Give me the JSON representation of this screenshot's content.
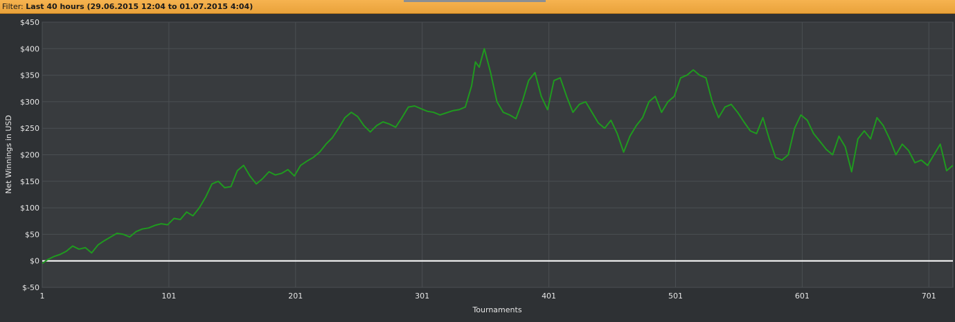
{
  "filter": {
    "label": "Filter:",
    "value": "Last 40 hours (29.06.2015 12:04 to 01.07.2015 4:04)"
  },
  "colors": {
    "background": "#2e3134",
    "plot_area": "#383b3e",
    "grid": "#4b4f53",
    "series_line": "#1f9a1f",
    "zero_line": "#ffffff",
    "filter_bar": "#f0aa45"
  },
  "chart_data": {
    "type": "line",
    "title": "",
    "xlabel": "Tournaments",
    "ylabel": "Net Winnings in USD",
    "xlim": [
      1,
      720
    ],
    "ylim": [
      -50,
      450
    ],
    "grid": true,
    "x_ticks": [
      1,
      101,
      201,
      301,
      401,
      501,
      601,
      701
    ],
    "y_ticks": [
      -50,
      0,
      50,
      100,
      150,
      200,
      250,
      300,
      350,
      400,
      450
    ],
    "y_tick_labels": [
      "$-50",
      "$0",
      "$50",
      "$100",
      "$150",
      "$200",
      "$250",
      "$300",
      "$350",
      "$400",
      "$450"
    ],
    "reference_lines": [
      {
        "y": 0,
        "color": "#ffffff"
      }
    ],
    "series": [
      {
        "color": "#1f9a1f",
        "x": [
          1,
          5,
          10,
          15,
          20,
          25,
          30,
          35,
          40,
          45,
          50,
          55,
          60,
          65,
          70,
          75,
          80,
          85,
          90,
          95,
          100,
          105,
          110,
          115,
          120,
          125,
          130,
          135,
          140,
          145,
          150,
          155,
          160,
          165,
          170,
          175,
          180,
          185,
          190,
          195,
          200,
          205,
          210,
          215,
          220,
          225,
          230,
          235,
          240,
          245,
          250,
          255,
          260,
          265,
          270,
          275,
          280,
          285,
          290,
          295,
          300,
          305,
          310,
          315,
          320,
          325,
          330,
          335,
          340,
          343,
          346,
          350,
          355,
          360,
          365,
          370,
          375,
          380,
          385,
          390,
          395,
          400,
          405,
          410,
          415,
          420,
          425,
          430,
          435,
          440,
          445,
          450,
          455,
          460,
          465,
          470,
          475,
          480,
          485,
          490,
          495,
          500,
          505,
          510,
          515,
          520,
          525,
          530,
          535,
          540,
          545,
          550,
          555,
          560,
          565,
          570,
          575,
          580,
          585,
          590,
          595,
          600,
          605,
          610,
          615,
          620,
          625,
          630,
          635,
          640,
          645,
          650,
          655,
          660,
          665,
          670,
          675,
          680,
          685,
          690,
          695,
          700,
          705,
          710,
          715,
          720
        ],
        "y": [
          -5,
          2,
          8,
          12,
          18,
          28,
          22,
          25,
          15,
          30,
          38,
          45,
          52,
          50,
          45,
          55,
          60,
          62,
          67,
          70,
          68,
          80,
          78,
          92,
          85,
          100,
          120,
          145,
          150,
          138,
          140,
          170,
          180,
          160,
          145,
          155,
          168,
          162,
          165,
          172,
          160,
          180,
          188,
          195,
          205,
          220,
          232,
          250,
          270,
          280,
          272,
          255,
          243,
          255,
          262,
          258,
          252,
          270,
          290,
          292,
          287,
          282,
          280,
          275,
          279,
          283,
          285,
          290,
          330,
          375,
          365,
          400,
          355,
          300,
          280,
          275,
          268,
          300,
          340,
          355,
          310,
          285,
          340,
          345,
          310,
          280,
          295,
          300,
          280,
          260,
          250,
          265,
          240,
          205,
          235,
          255,
          270,
          300,
          310,
          280,
          300,
          310,
          345,
          350,
          360,
          350,
          345,
          300,
          270,
          290,
          295,
          280,
          262,
          245,
          240,
          270,
          230,
          195,
          190,
          200,
          250,
          275,
          265,
          240,
          225,
          210,
          200,
          235,
          215,
          168,
          230,
          245,
          230,
          270,
          255,
          230,
          200,
          220,
          208,
          185,
          190,
          180,
          200,
          220,
          170,
          180
        ]
      }
    ]
  }
}
